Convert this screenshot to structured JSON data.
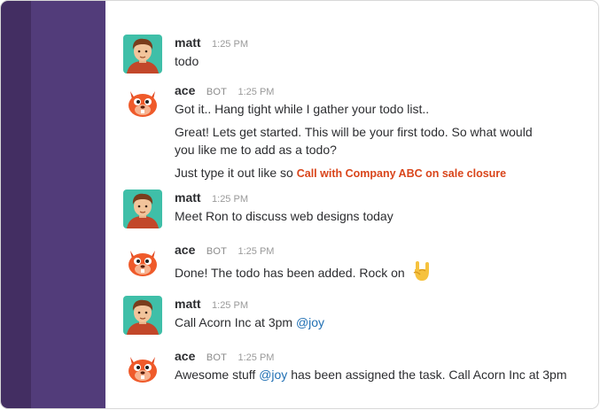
{
  "messages": [
    {
      "author": "matt",
      "bot": false,
      "time": "1:25 PM",
      "avatar": "matt-avatar",
      "lines": [
        "todo"
      ]
    },
    {
      "author": "ace",
      "bot": true,
      "bot_label": "BOT",
      "time": "1:25 PM",
      "avatar": "ace-bot-avatar",
      "lines": [
        "Got it.. Hang tight while I gather your todo list..",
        "Great! Lets get started. This will be your first todo. So what would you like me to add as a todo?"
      ],
      "hint_prefix": "Just type it out like so",
      "hint_example": "Call with Company ABC on sale closure"
    },
    {
      "author": "matt",
      "bot": false,
      "time": "1:25 PM",
      "avatar": "matt-avatar",
      "lines": [
        "Meet Ron to discuss web designs today"
      ]
    },
    {
      "author": "ace",
      "bot": true,
      "bot_label": "BOT",
      "time": "1:25 PM",
      "avatar": "ace-bot-avatar",
      "lines": [
        "Done! The todo has been added. Rock on"
      ],
      "emoji": "rock-on-hand-icon"
    },
    {
      "author": "matt",
      "bot": false,
      "time": "1:25 PM",
      "avatar": "matt-avatar",
      "text_prefix": "Call Acorn Inc at 3pm",
      "mention": "@joy"
    },
    {
      "author": "ace",
      "bot": true,
      "bot_label": "BOT",
      "time": "1:25 PM",
      "avatar": "ace-bot-avatar",
      "text_prefix": "Awesome stuff",
      "mention": "@joy",
      "text_suffix": "has been assigned the task. Call Acorn Inc at 3pm"
    }
  ],
  "colors": {
    "team_rail": "#432e62",
    "channel_sidebar": "#523c7a",
    "highlight": "#d9451b",
    "mention": "#1f6fb3"
  }
}
